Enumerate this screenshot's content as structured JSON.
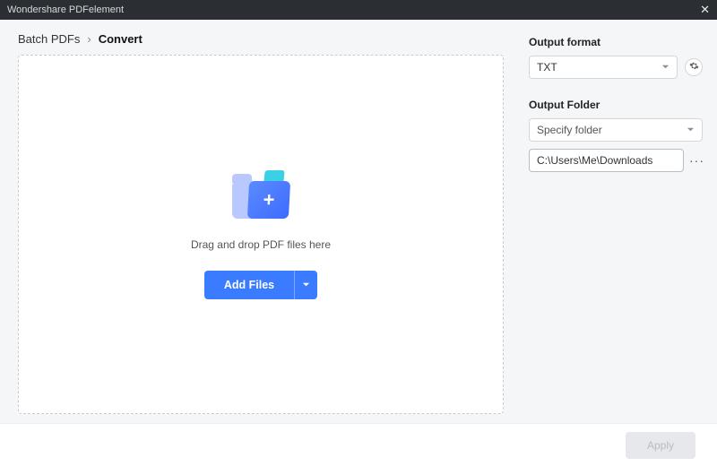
{
  "titlebar": {
    "title": "Wondershare PDFelement"
  },
  "breadcrumb": {
    "root": "Batch PDFs",
    "separator": "›",
    "current": "Convert"
  },
  "dropzone": {
    "hint": "Drag and drop PDF files here",
    "add_label": "Add Files"
  },
  "output_format": {
    "label": "Output format",
    "selected": "TXT"
  },
  "output_folder": {
    "label": "Output Folder",
    "mode": "Specify folder",
    "path": "C:\\Users\\Me\\Downloads",
    "browse": "···"
  },
  "footer": {
    "apply": "Apply"
  }
}
